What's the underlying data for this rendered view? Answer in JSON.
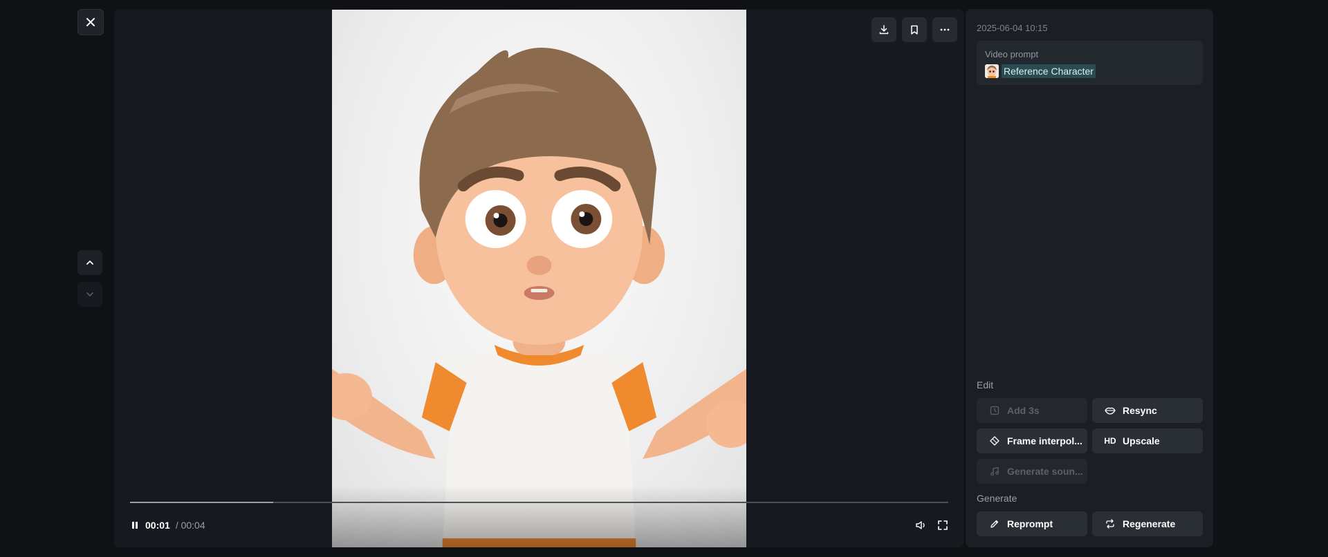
{
  "viewer": {
    "close_icon": "close-icon",
    "nav": {
      "up_icon": "chevron-up-icon",
      "down_icon": "chevron-down-icon"
    }
  },
  "player": {
    "top_actions": [
      {
        "name": "download-button",
        "icon": "download-icon"
      },
      {
        "name": "bookmark-button",
        "icon": "bookmark-icon"
      },
      {
        "name": "more-options-button",
        "icon": "more-horizontal-icon"
      }
    ],
    "progress_fraction": 0.175,
    "time_current": "00:01",
    "time_total": "/ 00:04",
    "controls": {
      "play_state_icon": "pause-icon",
      "volume_icon": "volume-icon",
      "fullscreen_icon": "fullscreen-icon"
    }
  },
  "side_panel": {
    "date": "2025-06-04 10:15",
    "prompt": {
      "title": "Video prompt",
      "reference_label": "Reference Character",
      "reference_icon": "character-thumbnail"
    },
    "edit": {
      "title": "Edit",
      "buttons": [
        {
          "label": "Add 3s",
          "icon": "add-time-icon",
          "enabled": false
        },
        {
          "label": "Resync",
          "icon": "lips-icon",
          "enabled": true
        },
        {
          "label": "Frame interpol...",
          "icon": "diamond-icon",
          "enabled": true
        },
        {
          "label": "Upscale",
          "icon": "hd-icon",
          "icon_text": "HD",
          "enabled": true
        },
        {
          "label": "Generate soun...",
          "icon": "music-note-icon",
          "enabled": false
        }
      ]
    },
    "generate": {
      "title": "Generate",
      "buttons": [
        {
          "label": "Reprompt",
          "icon": "pencil-icon",
          "enabled": true
        },
        {
          "label": "Regenerate",
          "icon": "repeat-icon",
          "enabled": true
        }
      ]
    }
  },
  "colors": {
    "background": "#0f1115",
    "panel": "#1b1e24",
    "button": "#2a2e35",
    "chip_highlight": "#2c4a52",
    "shirt_orange": "#ef8a2e"
  }
}
